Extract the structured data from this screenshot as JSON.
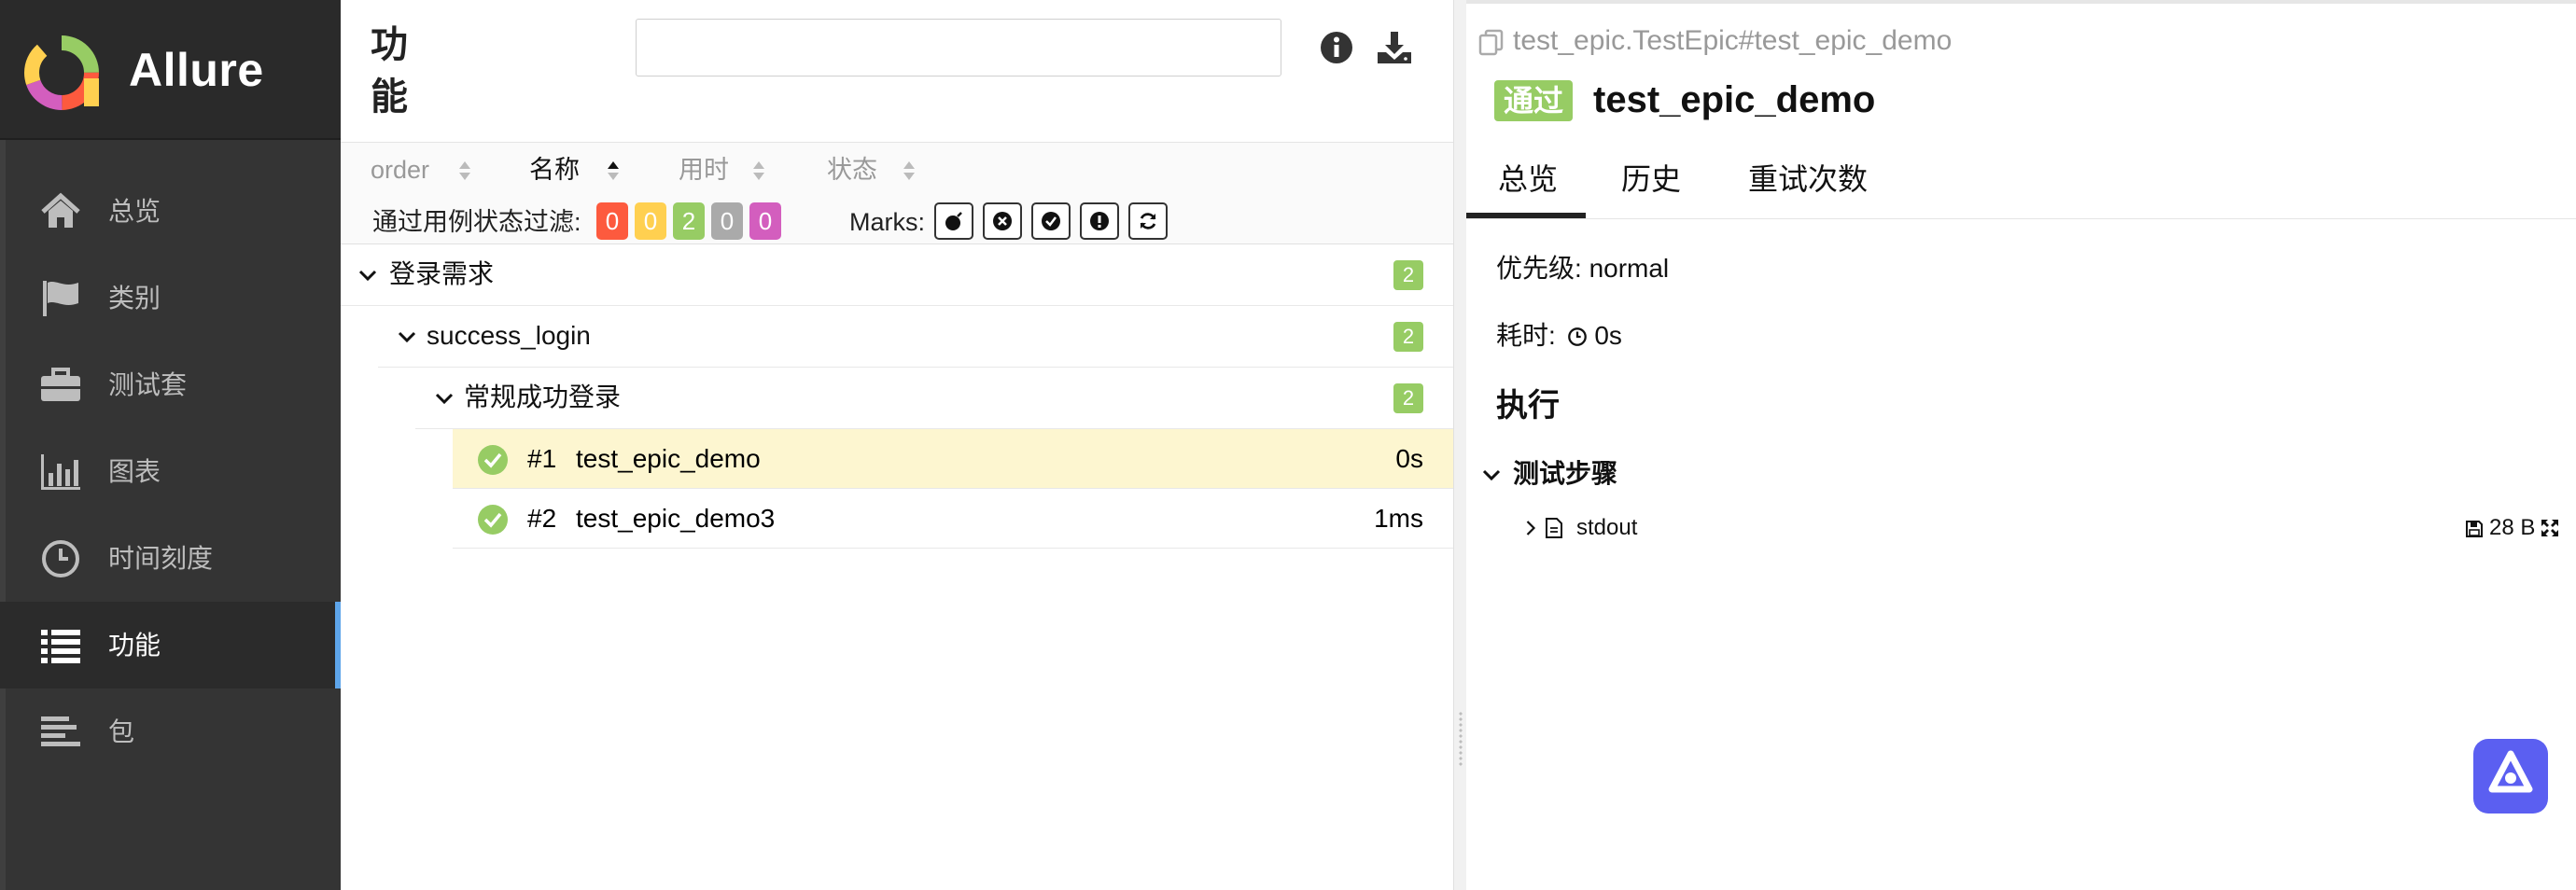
{
  "brand": {
    "name": "Allure"
  },
  "sidebar": {
    "items": [
      {
        "label": "总览",
        "icon": "home-icon"
      },
      {
        "label": "类别",
        "icon": "flag-icon"
      },
      {
        "label": "测试套",
        "icon": "briefcase-icon"
      },
      {
        "label": "图表",
        "icon": "bar-chart-icon"
      },
      {
        "label": "时间刻度",
        "icon": "clock-icon"
      },
      {
        "label": "功能",
        "icon": "list-icon",
        "active": true
      },
      {
        "label": "包",
        "icon": "align-left-icon"
      }
    ]
  },
  "middle": {
    "title": "功能",
    "search": {
      "value": "",
      "placeholder": ""
    },
    "sort": {
      "order": "order",
      "name": "名称",
      "duration": "用时",
      "status": "状态"
    },
    "filter": {
      "label": "通过用例状态过滤:",
      "counts": [
        "0",
        "0",
        "2",
        "0",
        "0"
      ],
      "colors": [
        "#fd5a3e",
        "#ffd050",
        "#97cc64",
        "#aaaaaa",
        "#d35ebe"
      ]
    },
    "marks_label": "Marks:",
    "tree": {
      "epic": {
        "label": "登录需求",
        "count": "2"
      },
      "feature": {
        "label": "success_login",
        "count": "2"
      },
      "story": {
        "label": "常规成功登录",
        "count": "2"
      },
      "cases": [
        {
          "num": "#1",
          "name": "test_epic_demo",
          "duration": "0s",
          "selected": true
        },
        {
          "num": "#2",
          "name": "test_epic_demo3",
          "duration": "1ms",
          "selected": false
        }
      ]
    }
  },
  "detail": {
    "path": "test_epic.TestEpic#test_epic_demo",
    "status": "通过",
    "title": "test_epic_demo",
    "tabs": [
      "总览",
      "历史",
      "重试次数"
    ],
    "severity_label": "优先级:",
    "severity_value": "normal",
    "duration_label": "耗时:",
    "duration_value": "0s",
    "execution_title": "执行",
    "steps_title": "测试步骤",
    "attachment": {
      "name": "stdout",
      "size": "28 B"
    }
  },
  "colors": {
    "sidebar_bg": "#343434",
    "passed": "#97cc64",
    "accent": "#5ea5ea",
    "fab": "#5b5ff1"
  }
}
